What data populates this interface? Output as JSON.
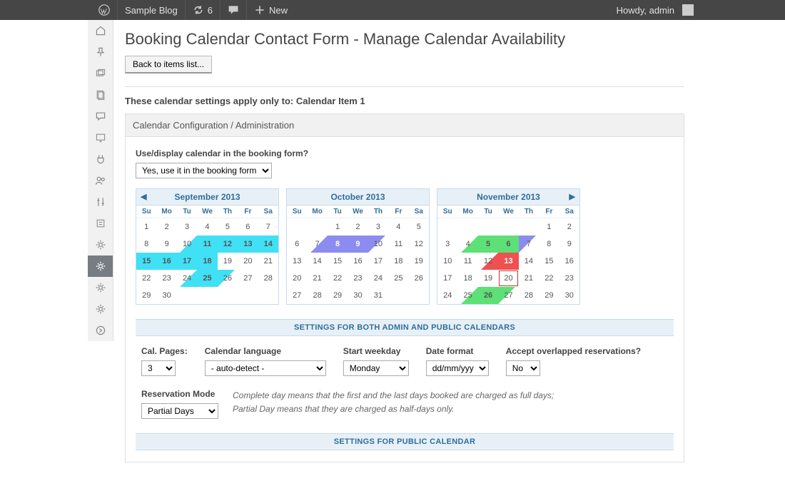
{
  "adminbar": {
    "site": "Sample Blog",
    "updates": "6",
    "new": "New",
    "howdy": "Howdy, admin"
  },
  "page": {
    "title": "Booking Calendar Contact Form - Manage Calendar Availability",
    "back": "Back to items list...",
    "applies_prefix": "These calendar settings apply only to: ",
    "applies_item": "Calendar Item 1",
    "panel_header": "Calendar Configuration / Administration"
  },
  "use": {
    "question": "Use/display calendar in the booking form?",
    "value": "Yes, use it in the booking form"
  },
  "dow": [
    "Su",
    "Mo",
    "Tu",
    "We",
    "Th",
    "Fr",
    "Sa"
  ],
  "months": [
    {
      "title": "September 2013",
      "prev": true,
      "next": false,
      "lead": 0,
      "days": [
        {
          "n": 1
        },
        {
          "n": 2
        },
        {
          "n": 3
        },
        {
          "n": 4
        },
        {
          "n": 5
        },
        {
          "n": 6
        },
        {
          "n": 7
        },
        {
          "n": 8
        },
        {
          "n": 9
        },
        {
          "n": 10,
          "half_br": "#40e0f5"
        },
        {
          "n": 11,
          "cls": "cyan"
        },
        {
          "n": 12,
          "cls": "cyan"
        },
        {
          "n": 13,
          "cls": "cyan"
        },
        {
          "n": 14,
          "cls": "cyan"
        },
        {
          "n": 15,
          "cls": "cyan"
        },
        {
          "n": 16,
          "cls": "cyan"
        },
        {
          "n": 17,
          "cls": "cyan"
        },
        {
          "n": 18,
          "cls": "cyan"
        },
        {
          "n": 19
        },
        {
          "n": 20
        },
        {
          "n": 21
        },
        {
          "n": 22
        },
        {
          "n": 23
        },
        {
          "n": 24,
          "half_br": "#40e0f5"
        },
        {
          "n": 25,
          "cls": "cyan"
        },
        {
          "n": 26,
          "half_tl": "#40e0f5"
        },
        {
          "n": 27
        },
        {
          "n": 28
        },
        {
          "n": 29
        },
        {
          "n": 30
        }
      ]
    },
    {
      "title": "October 2013",
      "prev": false,
      "next": false,
      "lead": 2,
      "days": [
        {
          "n": 1
        },
        {
          "n": 2
        },
        {
          "n": 3
        },
        {
          "n": 4
        },
        {
          "n": 5
        },
        {
          "n": 6
        },
        {
          "n": 7,
          "half_br": "#8c8cf0"
        },
        {
          "n": 8,
          "cls": "purple"
        },
        {
          "n": 9,
          "cls": "purple"
        },
        {
          "n": 10,
          "half_tl": "#8c8cf0"
        },
        {
          "n": 11
        },
        {
          "n": 12
        },
        {
          "n": 13
        },
        {
          "n": 14
        },
        {
          "n": 15
        },
        {
          "n": 16
        },
        {
          "n": 17
        },
        {
          "n": 18
        },
        {
          "n": 19
        },
        {
          "n": 20
        },
        {
          "n": 21
        },
        {
          "n": 22
        },
        {
          "n": 23
        },
        {
          "n": 24
        },
        {
          "n": 25
        },
        {
          "n": 26
        },
        {
          "n": 27
        },
        {
          "n": 28
        },
        {
          "n": 29
        },
        {
          "n": 30
        },
        {
          "n": 31
        }
      ]
    },
    {
      "title": "November 2013",
      "prev": false,
      "next": true,
      "lead": 5,
      "days": [
        {
          "n": 1
        },
        {
          "n": 2
        },
        {
          "n": 3
        },
        {
          "n": 4,
          "half_br": "#5de075"
        },
        {
          "n": 5,
          "cls": "green"
        },
        {
          "n": 6,
          "cls": "green"
        },
        {
          "n": 7,
          "half_tl": "#8c8cf0"
        },
        {
          "n": 8
        },
        {
          "n": 9
        },
        {
          "n": 10
        },
        {
          "n": 11
        },
        {
          "n": 12,
          "half_br": "#f05050"
        },
        {
          "n": 13,
          "cls": "red"
        },
        {
          "n": 14
        },
        {
          "n": 15
        },
        {
          "n": 16
        },
        {
          "n": 17
        },
        {
          "n": 18
        },
        {
          "n": 19
        },
        {
          "n": 20,
          "today": true
        },
        {
          "n": 21
        },
        {
          "n": 22
        },
        {
          "n": 23
        },
        {
          "n": 24
        },
        {
          "n": 25,
          "half_br": "#5de075"
        },
        {
          "n": 26,
          "cls": "green"
        },
        {
          "n": 27,
          "half_tl": "#5de075"
        },
        {
          "n": 28
        },
        {
          "n": 29
        },
        {
          "n": 30
        }
      ]
    }
  ],
  "sections": {
    "both": "SETTINGS FOR BOTH ADMIN AND PUBLIC CALENDARS",
    "public": "SETTINGS FOR PUBLIC CALENDAR"
  },
  "settings": {
    "pages": {
      "label": "Cal. Pages:",
      "value": "3"
    },
    "lang": {
      "label": "Calendar language",
      "value": "- auto-detect -"
    },
    "startwd": {
      "label": "Start weekday",
      "value": "Monday"
    },
    "datefmt": {
      "label": "Date format",
      "value": "dd/mm/yyyy"
    },
    "overlap": {
      "label": "Accept overlapped reservations?",
      "value": "No"
    },
    "resmode": {
      "label": "Reservation Mode",
      "value": "Partial Days"
    },
    "hint1": "Complete day means that the first and the last days booked are charged as full days;",
    "hint2": "Partial Day means that they are charged as half-days only."
  }
}
